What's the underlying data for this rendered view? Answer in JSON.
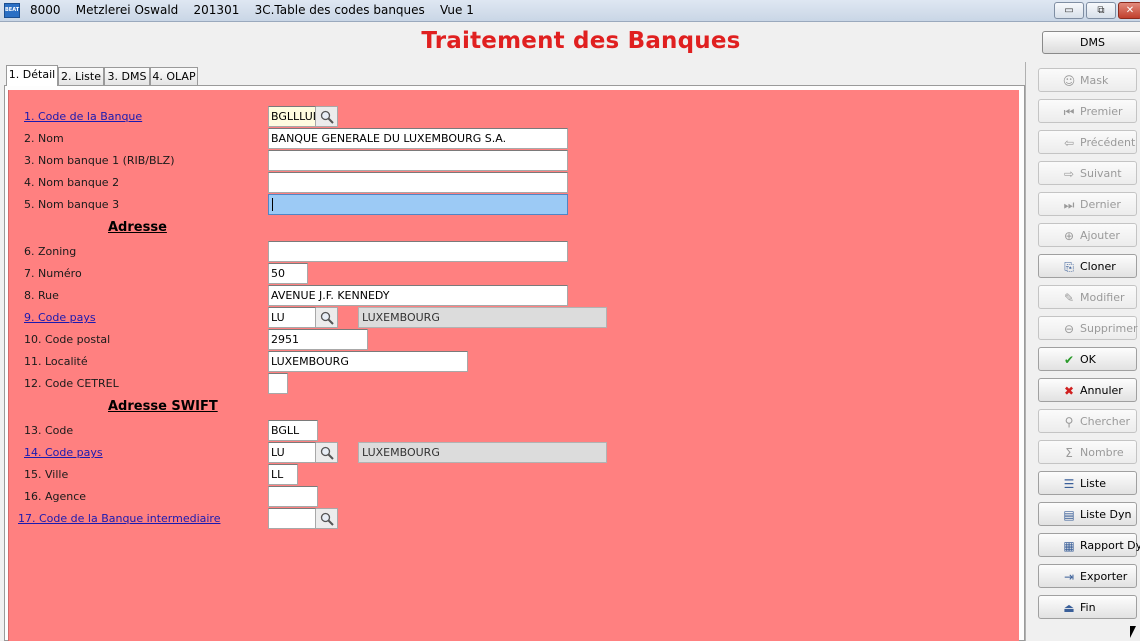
{
  "window": {
    "title": "8000    Metzlerei Oswald    201301    3C.Table des codes banques    Vue 1",
    "app_icon_text": "BEAT",
    "minimize_label": "▭",
    "maximize_label": "⧉",
    "close_label": "✕"
  },
  "header": {
    "title": "Traitement des Banques",
    "dms_button": "DMS"
  },
  "tabs": [
    {
      "label": "1. Détail",
      "active": true
    },
    {
      "label": "2. Liste",
      "active": false
    },
    {
      "label": "3. DMS",
      "active": false
    },
    {
      "label": "4. OLAP",
      "active": false
    }
  ],
  "form": {
    "sections": {
      "adresse": "Adresse",
      "adresse_swift": "Adresse SWIFT"
    },
    "fields": {
      "code_banque": {
        "label": "1. Code de la Banque",
        "value": "BGLLLULL"
      },
      "nom": {
        "label": "2. Nom",
        "value": "BANQUE GENERALE DU LUXEMBOURG S.A."
      },
      "nom_banque_1": {
        "label": "3. Nom banque 1 (RIB/BLZ)",
        "value": ""
      },
      "nom_banque_2": {
        "label": "4. Nom banque 2",
        "value": ""
      },
      "nom_banque_3": {
        "label": "5. Nom banque 3",
        "value": ""
      },
      "zoning": {
        "label": "6. Zoning",
        "value": ""
      },
      "numero": {
        "label": "7. Numéro",
        "value": "50"
      },
      "rue": {
        "label": "8. Rue",
        "value": "AVENUE J.F. KENNEDY"
      },
      "code_pays": {
        "label": "9. Code pays",
        "value": "LU",
        "description": "LUXEMBOURG"
      },
      "code_postal": {
        "label": "10. Code postal",
        "value": "2951"
      },
      "localite": {
        "label": "11. Localité",
        "value": "LUXEMBOURG"
      },
      "code_cetrel": {
        "label": "12. Code CETREL",
        "value": ""
      },
      "swift_code": {
        "label": "13. Code",
        "value": "BGLL"
      },
      "swift_code_pays": {
        "label": "14. Code pays",
        "value": "LU",
        "description": "LUXEMBOURG"
      },
      "ville": {
        "label": "15. Ville",
        "value": "LL"
      },
      "agence": {
        "label": "16. Agence",
        "value": ""
      },
      "banque_intermediaire": {
        "label": "17. Code de la Banque intermediaire",
        "value": ""
      }
    }
  },
  "toolbar": [
    {
      "label": "Mask",
      "icon": "mask-icon",
      "glyph": "☺",
      "enabled": false
    },
    {
      "label": "Premier",
      "icon": "first-icon",
      "glyph": "⏮",
      "enabled": false
    },
    {
      "label": "Précédent",
      "icon": "previous-icon",
      "glyph": "⇦",
      "enabled": false
    },
    {
      "label": "Suivant",
      "icon": "next-icon",
      "glyph": "⇨",
      "enabled": false
    },
    {
      "label": "Dernier",
      "icon": "last-icon",
      "glyph": "⏭",
      "enabled": false
    },
    {
      "label": "Ajouter",
      "icon": "add-icon",
      "glyph": "⊕",
      "enabled": false
    },
    {
      "label": "Cloner",
      "icon": "clone-icon",
      "glyph": "⎘",
      "enabled": true
    },
    {
      "label": "Modifier",
      "icon": "edit-icon",
      "glyph": "✎",
      "enabled": false
    },
    {
      "label": "Supprimer",
      "icon": "delete-icon",
      "glyph": "⊖",
      "enabled": false
    },
    {
      "label": "OK",
      "icon": "ok-check-icon",
      "glyph": "✔",
      "enabled": true
    },
    {
      "label": "Annuler",
      "icon": "cancel-x-icon",
      "glyph": "✖",
      "enabled": true
    },
    {
      "label": "Chercher",
      "icon": "search-icon",
      "glyph": "⚲",
      "enabled": false
    },
    {
      "label": "Nombre",
      "icon": "sigma-icon",
      "glyph": "Σ",
      "enabled": false
    },
    {
      "label": "Liste",
      "icon": "list-icon",
      "glyph": "☰",
      "enabled": true
    },
    {
      "label": "Liste Dyn",
      "icon": "dynamic-list-icon",
      "glyph": "▤",
      "enabled": true
    },
    {
      "label": "Rapport Dyn",
      "icon": "report-icon",
      "glyph": "▦",
      "enabled": true
    },
    {
      "label": "Exporter",
      "icon": "export-icon",
      "glyph": "⇥",
      "enabled": true
    },
    {
      "label": "Fin",
      "icon": "exit-icon",
      "glyph": "⏏",
      "enabled": true
    }
  ],
  "colors": {
    "title": "#e02020",
    "form_background": "#ff8080",
    "link": "#1a1ab0",
    "focused_field": "#9ccaf5",
    "ok_icon": "#2a9a2a",
    "cancel_icon": "#d02020"
  }
}
